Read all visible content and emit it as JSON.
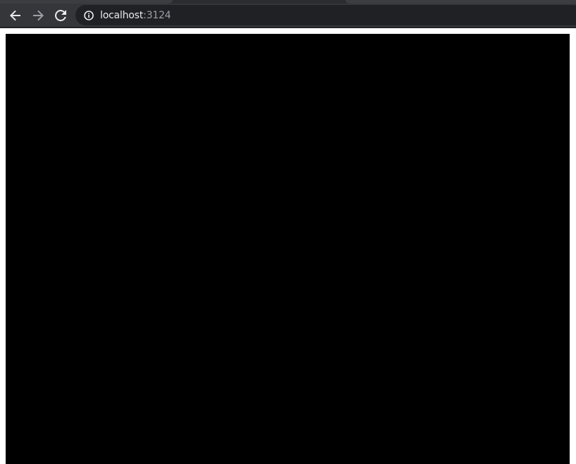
{
  "browser": {
    "address_bar": {
      "host": "localhost",
      "port": ":3124"
    },
    "icons": {
      "back": "arrow-left-icon",
      "forward": "arrow-right-icon",
      "reload": "reload-icon",
      "site_info": "info-icon"
    },
    "colors": {
      "toolbar": "#35363a",
      "omnibox": "#202124",
      "canvas": "#000000"
    }
  }
}
